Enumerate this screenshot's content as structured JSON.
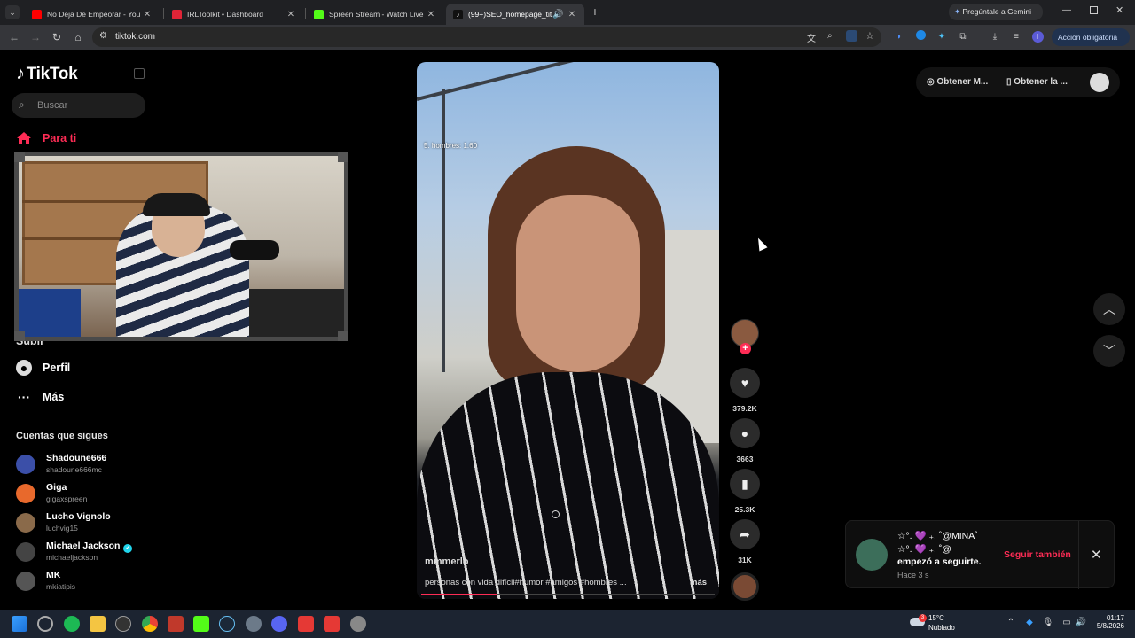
{
  "browser": {
    "tabs": [
      {
        "title": "No Deja De Empeorar - YouTube",
        "color": "#ff0000",
        "active": false
      },
      {
        "title": "IRLToolkit • Dashboard",
        "color": "#e02437",
        "active": false
      },
      {
        "title": "Spreen Stream - Watch Live on",
        "color": "#53fc18",
        "active": false
      },
      {
        "title": "(99+)SEO_homepage_title",
        "color": "#ffffff",
        "active": true
      }
    ],
    "new_tab": "+",
    "gemini_button": "Pregúntale a Gemini",
    "url": "tiktok.com",
    "profile_initial": "I",
    "accion_obligatoria": "Acción obligatoria"
  },
  "tiktok": {
    "logo": "TikTok",
    "search_placeholder": "Buscar",
    "nav": {
      "para_ti": "Para ti",
      "subir": "Subir",
      "perfil": "Perfil",
      "mas": "Más"
    },
    "following_title": "Cuentas que sigues",
    "following": [
      {
        "name": "Shadoune666",
        "handle": "shadoune666mc",
        "color": "#3b4fa8",
        "verified": false
      },
      {
        "name": "Giga",
        "handle": "gigaxspreen",
        "color": "#e8692c",
        "verified": false
      },
      {
        "name": "Lucho Vignolo",
        "handle": "luchvig15",
        "color": "#8a6a4a",
        "verified": false
      },
      {
        "name": "Michael Jackson",
        "handle": "michaeljackson",
        "color": "#444444",
        "verified": true
      },
      {
        "name": "MK",
        "handle": "mkiatipis",
        "color": "#555555",
        "verified": false
      }
    ],
    "video": {
      "overlay_text": "5. hombres: 1.60",
      "username": "mmmerlo",
      "caption": "personas con vida difícil#humor #amigos #hombres ...",
      "more": "más",
      "progress": 0.26
    },
    "actions": {
      "likes": "379.2K",
      "comments": "3663",
      "saves": "25.3K",
      "shares": "31K"
    },
    "top_right": {
      "get_coins": "Obtener M...",
      "get_app": "Obtener la ..."
    },
    "notification": {
      "name_line1": "☆°. 💜 ₊. ˚@MINA˚",
      "name_line2": "☆°. 💜 ₊. ˚@",
      "message": "empezó a seguirte.",
      "time": "Hace 3 s",
      "follow_back": "Seguir también"
    }
  },
  "taskbar": {
    "weather_temp": "15°C",
    "weather_cond": "Nublado",
    "weather_badge": "3",
    "time": "01:17",
    "date": "5/8/2026"
  },
  "colors": {
    "accent": "#fe2c55",
    "background": "#000000"
  }
}
